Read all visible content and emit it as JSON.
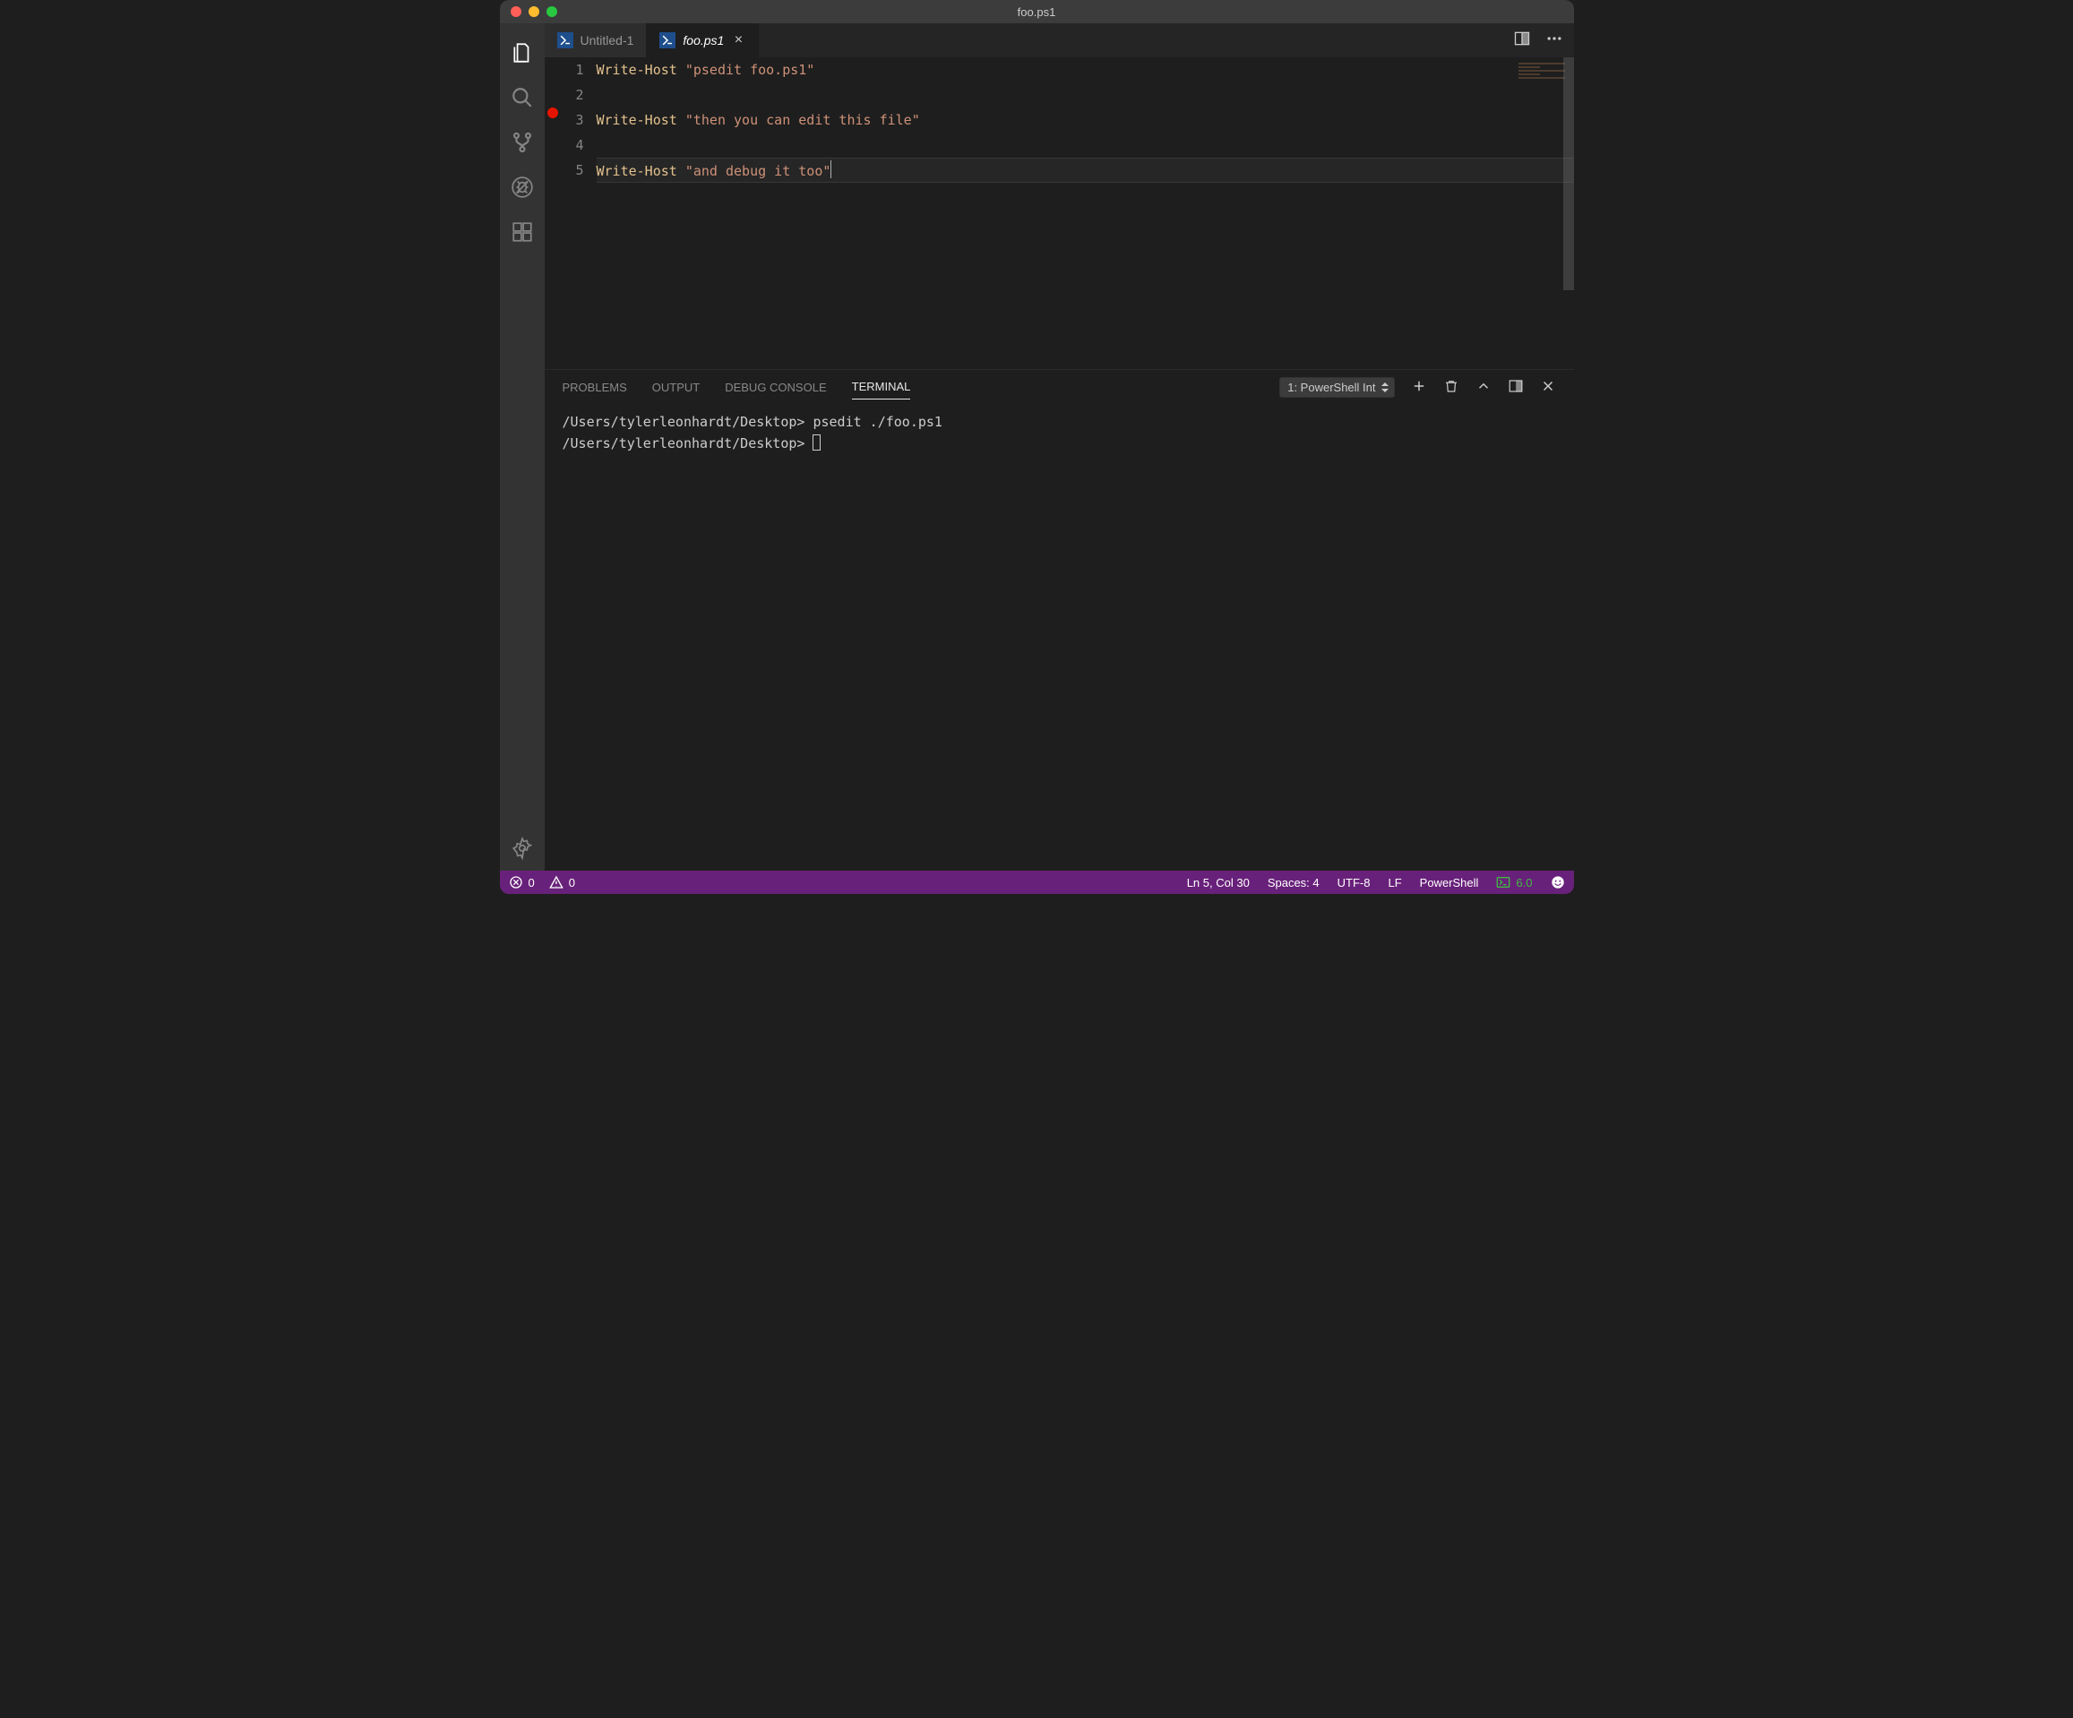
{
  "titlebar": {
    "title": "foo.ps1"
  },
  "tabs": [
    {
      "label": "Untitled-1",
      "active": false
    },
    {
      "label": "foo.ps1",
      "active": true
    }
  ],
  "editor": {
    "breakpoint_line": 3,
    "current_line": 5,
    "lines": [
      {
        "num": "1",
        "cmd": "Write-Host",
        "str": "\"psedit foo.ps1\""
      },
      {
        "num": "2",
        "cmd": "",
        "str": ""
      },
      {
        "num": "3",
        "cmd": "Write-Host",
        "str": "\"then you can edit this file\""
      },
      {
        "num": "4",
        "cmd": "",
        "str": ""
      },
      {
        "num": "5",
        "cmd": "Write-Host",
        "str": "\"and debug it too\""
      }
    ]
  },
  "panel": {
    "tabs": {
      "problems": "PROBLEMS",
      "output": "OUTPUT",
      "debug": "DEBUG CONSOLE",
      "terminal": "TERMINAL"
    },
    "terminal_selector": "1: PowerShell Int",
    "terminal_lines": [
      {
        "prompt": "/Users/tylerleonhardt/Desktop>",
        "cmd": "psedit ./foo.ps1"
      },
      {
        "prompt": "/Users/tylerleonhardt/Desktop>",
        "cmd": ""
      }
    ]
  },
  "status": {
    "errors": "0",
    "warnings": "0",
    "cursor": "Ln 5, Col 30",
    "spaces": "Spaces: 4",
    "encoding": "UTF-8",
    "eol": "LF",
    "language": "PowerShell",
    "ps_version": "6.0"
  }
}
